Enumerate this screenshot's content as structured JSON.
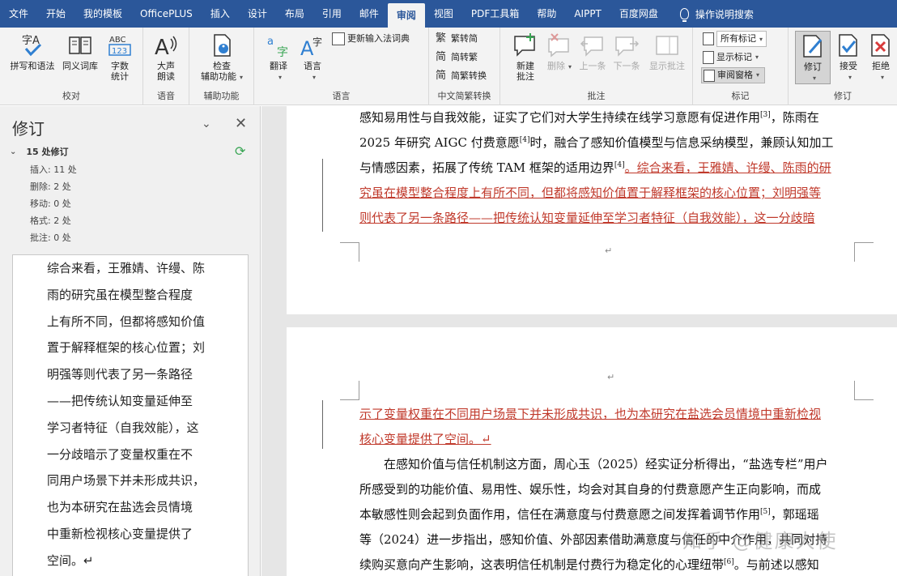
{
  "menu": {
    "items": [
      "文件",
      "开始",
      "我的模板",
      "OfficePLUS",
      "插入",
      "设计",
      "布局",
      "引用",
      "邮件",
      "审阅",
      "视图",
      "PDF工具箱",
      "帮助",
      "AIPPT",
      "百度网盘"
    ],
    "active": "审阅",
    "search_label": "操作说明搜索"
  },
  "ribbon": {
    "proofing": {
      "label": "校对",
      "spelling": "拼写和语法",
      "thesaurus": "同义词库",
      "wordcount_1": "字数",
      "wordcount_2": "统计"
    },
    "speech": {
      "label": "语音",
      "read_1": "大声",
      "read_2": "朗读"
    },
    "accessibility": {
      "label": "辅助功能",
      "check_1": "检查",
      "check_2": "辅助功能"
    },
    "language": {
      "label": "语言",
      "translate": "翻译",
      "language": "语言",
      "update_ime": "更新输入法词典"
    },
    "chinese": {
      "label": "中文简繁转换",
      "to_trad": "繁转简",
      "to_simp": "简转繁",
      "convert": "简繁转换"
    },
    "comments": {
      "label": "批注",
      "new_1": "新建",
      "new_2": "批注",
      "delete": "删除",
      "prev": "上一条",
      "next": "下一条",
      "show": "显示批注"
    },
    "tracking": {
      "label": "标记",
      "markup_select": "所有标记",
      "show_markup": "显示标记",
      "review_pane": "审阅窗格"
    },
    "revisions": {
      "label": "修订",
      "track": "修订",
      "accept": "接受",
      "reject": "拒绝"
    }
  },
  "sidebar": {
    "title": "修订",
    "summary": "15 处修订",
    "stats": [
      "插入: 11 处",
      "删除: 2 处",
      "移动: 0 处",
      "格式: 2 处",
      "批注: 0 处"
    ],
    "card_lines": [
      "综合来看，王雅婧、许缦、陈",
      "雨的研究虽在模型整合程度",
      "上有所不同，但都将感知价值",
      "置于解释框架的核心位置；刘",
      "明强等则代表了另一条路径",
      "——把传统认知变量延伸至",
      "学习者特征（自我效能），这",
      "一分歧暗示了变量权重在不",
      "同用户场景下并未形成共识，",
      "也为本研究在盐选会员情境",
      "中重新检视核心变量提供了",
      "空间。↵"
    ]
  },
  "document": {
    "page1_lines": [
      {
        "text": "感知易用性与自我效能，证实了它们对大学生持续在线学习意愿有促进作用",
        "sup": "[3]",
        "after": "，陈雨在",
        "rev": false
      },
      {
        "text": "2025 年研究 AIGC 付费意愿",
        "sup": "[4]",
        "after": "时，融合了感知价值模型与信息采纳模型，兼顾认知加工",
        "rev": false
      },
      {
        "text": "与情感因素，拓展了传统 TAM 框架的适用边界",
        "sup": "[4]",
        "after": "。综合来看，王雅婧、许缦、陈雨的研",
        "rev": false,
        "rev_start": true
      },
      {
        "text": "究虽在模型整合程度上有所不同，但都将感知价值置于解释框架的核心位置；刘明强等",
        "sup": "",
        "after": "",
        "rev": true
      },
      {
        "text": "则代表了另一条路径——把传统认知变量延伸至学习者特征（自我效能），这一分歧暗",
        "sup": "",
        "after": "",
        "rev": true
      }
    ],
    "page2_lines": [
      {
        "text": "示了变量权重在不同用户场景下并未形成共识，也为本研究在盐选会员情境中重新检视",
        "sup": "",
        "after": "",
        "rev": true
      },
      {
        "text": "核心变量提供了空间。↵",
        "sup": "",
        "after": "",
        "rev": true
      },
      {
        "text": "　　在感知价值与信任机制这方面，周心玉（2025）经实证分析得出，“盐选专栏”用户",
        "sup": "",
        "after": "",
        "rev": false
      },
      {
        "text": "所感受到的功能价值、易用性、娱乐性，均会对其自身的付费意愿产生正向影响，而成",
        "sup": "",
        "after": "",
        "rev": false
      },
      {
        "text": "本敏感性则会起到负面作用，信任在满意度与付费意愿之间发挥着调节作用",
        "sup": "[5]",
        "after": "，郭瑶瑶",
        "rev": false
      },
      {
        "text": "等（2024）进一步指出，感知价值、外部因素借助满意度与信任的中介作用，共同对持",
        "sup": "",
        "after": "",
        "rev": false
      },
      {
        "text": "续购买意向产生影响，这表明信任机制是付费行为稳定化的心理纽带",
        "sup": "[6]",
        "after": "。与前述以感知",
        "rev": false
      }
    ],
    "watermark": "知乎 @健康大使"
  }
}
